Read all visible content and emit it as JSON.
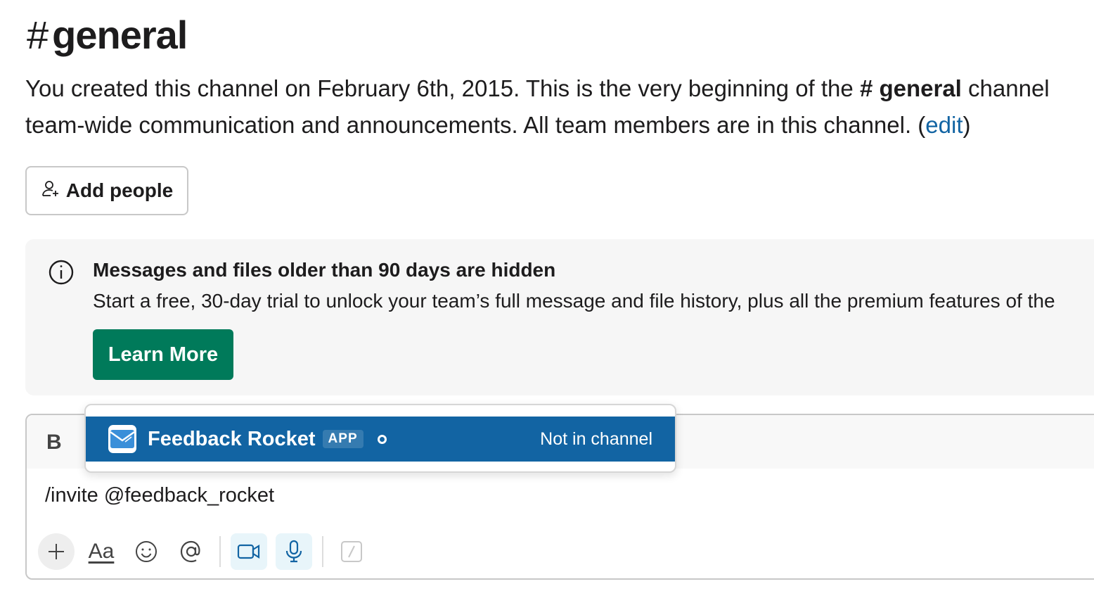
{
  "channel": {
    "hash": "#",
    "name": "general"
  },
  "intro": {
    "line1_prefix": "You created this channel on February 6th, 2015. This is the very beginning of the ",
    "line1_hash": "#",
    "line1_channel": "general",
    "line1_suffix": " channel",
    "line2_prefix": "team-wide communication and announcements. All team members are in this channel. (",
    "line2_link": "edit",
    "line2_suffix": ")"
  },
  "add_people": {
    "label": "Add people"
  },
  "banner": {
    "title": "Messages and files older than 90 days are hidden",
    "text": "Start a free, 30-day trial to unlock your team’s full message and file history, plus all the premium features of the",
    "button_label": "Learn More",
    "button_color": "#007a5a"
  },
  "composer": {
    "bold_label": "B",
    "message_text": "/invite @feedback_rocket",
    "tools": [
      "plus-icon",
      "formatting-icon",
      "emoji-icon",
      "mention-icon",
      "video-icon",
      "microphone-icon",
      "slash-command-icon"
    ],
    "formatting_label": "Aa"
  },
  "suggestion": {
    "app_name": "Feedback Rocket",
    "badge": "APP",
    "status": "Not in channel",
    "highlight_color": "#1264a3"
  }
}
